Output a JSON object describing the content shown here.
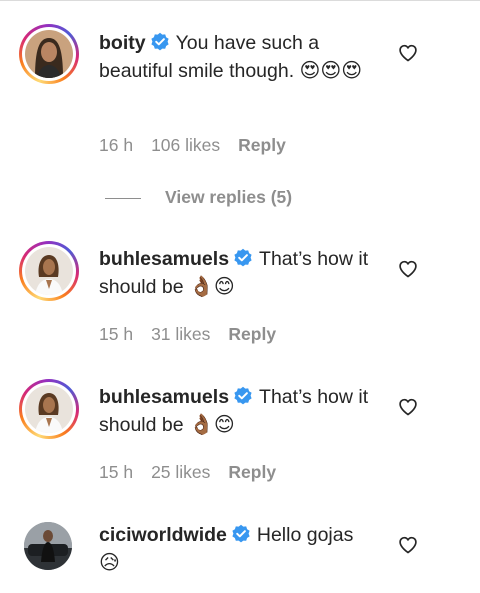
{
  "comments": [
    {
      "username": "boity",
      "text": "You have such a beautiful smile though.",
      "emojis": "😍😍😍",
      "time": "16 h",
      "likes": "106 likes",
      "reply": "Reply",
      "view_replies": "View replies (5)"
    },
    {
      "username": "buhlesamuels",
      "text": "That’s how it should be",
      "emojis": "👌🏾😊",
      "time": "15 h",
      "likes": "31 likes",
      "reply": "Reply"
    },
    {
      "username": "buhlesamuels",
      "text": "That’s how it should be",
      "emojis": "👌🏾😊",
      "time": "15 h",
      "likes": "25 likes",
      "reply": "Reply"
    },
    {
      "username": "ciciworldwide",
      "text": "Hello gojas",
      "emojis": "😥"
    }
  ],
  "colors": {
    "verified": "#3897f0",
    "muted": "#8e8e8e",
    "text": "#262626"
  },
  "icons": [
    "verified-badge-icon",
    "heart-outline-icon"
  ]
}
